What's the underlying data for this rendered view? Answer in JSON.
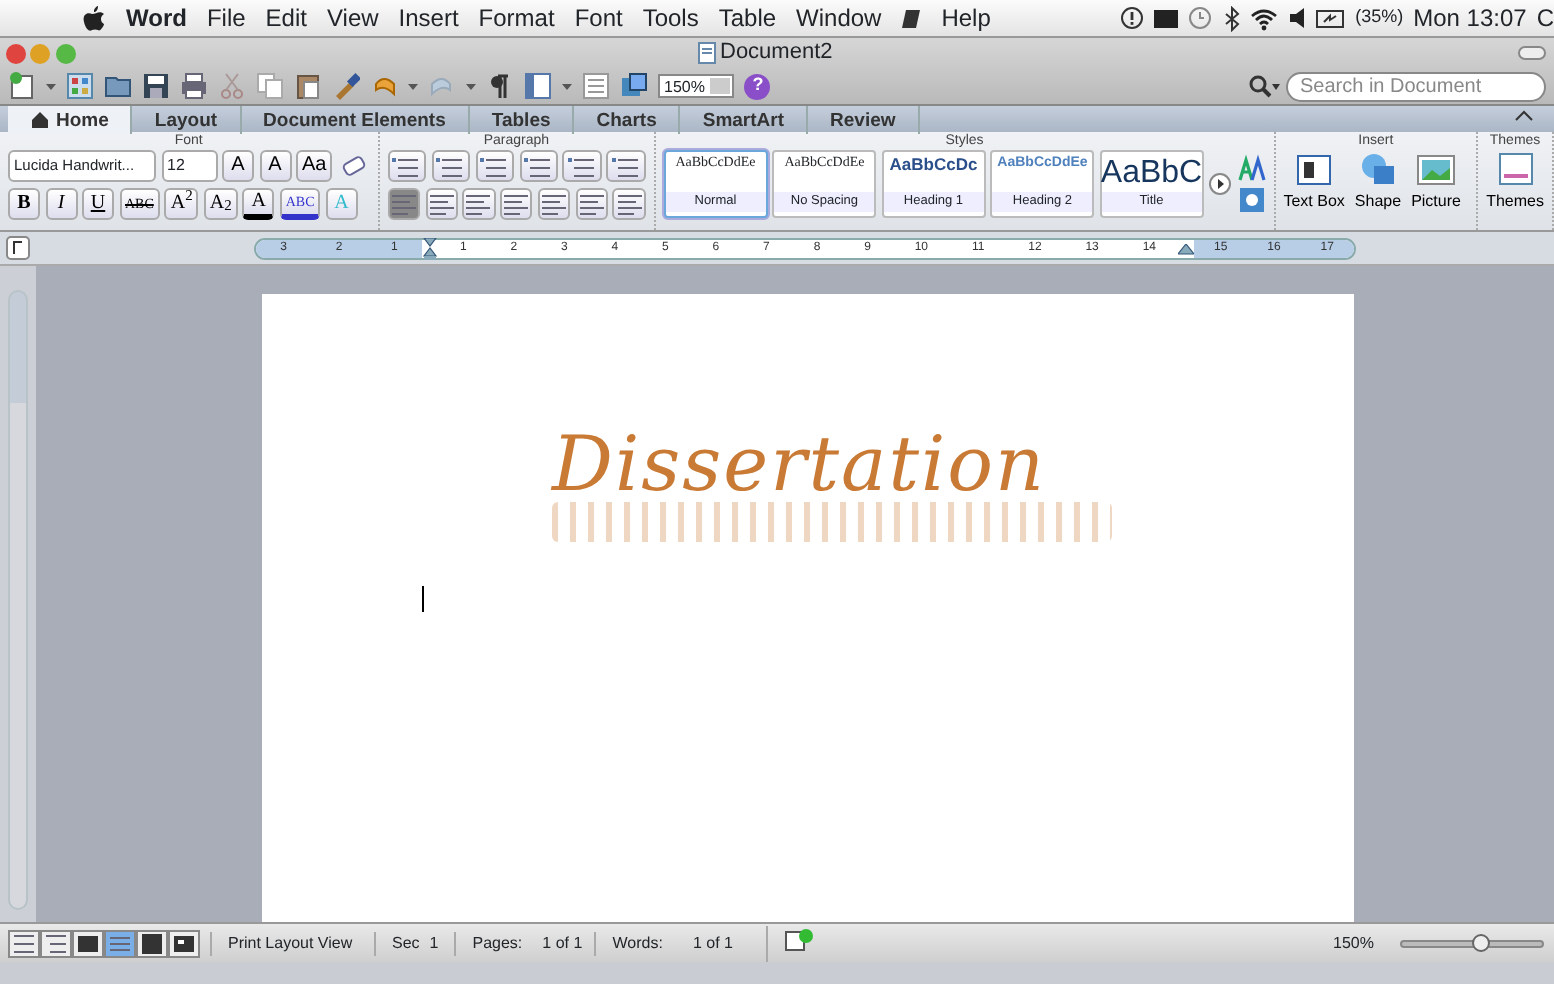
{
  "menu_bar": {
    "app": "Word",
    "items": [
      "File",
      "Edit",
      "View",
      "Insert",
      "Format",
      "Font",
      "Tools",
      "Table",
      "Window",
      "Help"
    ],
    "battery": "(35%)",
    "clock": "Mon 13:07",
    "cut_item": "C"
  },
  "window": {
    "title": "Document2"
  },
  "toolbar": {
    "zoom": "150%",
    "help": "?",
    "search": {
      "placeholder": "Search in Document"
    }
  },
  "tabs": [
    {
      "label": "Home",
      "selected": true
    },
    {
      "label": "Layout",
      "selected": false
    },
    {
      "label": "Document Elements",
      "selected": false
    },
    {
      "label": "Tables",
      "selected": false
    },
    {
      "label": "Charts",
      "selected": false
    },
    {
      "label": "SmartArt",
      "selected": false
    },
    {
      "label": "Review",
      "selected": false
    }
  ],
  "ribbon": {
    "font": {
      "title": "Font",
      "font_name": "Lucida Handwrit...",
      "font_size": "12",
      "row1": [
        "A",
        "A",
        "Aa"
      ],
      "row2": [
        "B",
        "I",
        "U",
        "ABC",
        "A$^{2}$",
        "A$_{2}$",
        "A",
        "ABC",
        "A"
      ]
    },
    "paragraph": {
      "title": "Paragraph"
    },
    "styles": {
      "title": "Styles",
      "items": [
        {
          "sample": "AaBbCcDdEe",
          "name": "Normal",
          "selected": true,
          "kind": "normal"
        },
        {
          "sample": "AaBbCcDdEe",
          "name": "No Spacing",
          "selected": false,
          "kind": "normal"
        },
        {
          "sample": "AaBbCcDc",
          "name": "Heading 1",
          "selected": false,
          "kind": "heading1"
        },
        {
          "sample": "AaBbCcDdEe",
          "name": "Heading 2",
          "selected": false,
          "kind": "heading2"
        },
        {
          "sample": "AaBbC",
          "name": "Title",
          "selected": false,
          "kind": "title"
        }
      ]
    },
    "insert": {
      "title": "Insert",
      "items": [
        "Text Box",
        "Shape",
        "Picture"
      ]
    },
    "themes": {
      "title": "Themes",
      "items": [
        "Themes"
      ]
    }
  },
  "ruler": {
    "left_labels": [
      "3",
      "2",
      "1"
    ],
    "right_labels": [
      "1",
      "2",
      "3",
      "4",
      "5",
      "6",
      "7",
      "8",
      "9",
      "10",
      "11",
      "12",
      "13",
      "14",
      "15",
      "16",
      "17"
    ]
  },
  "document": {
    "title": "Dissertation",
    "reflection": true
  },
  "status_bar": {
    "views": [
      {
        "selected": false
      },
      {
        "selected": false
      },
      {
        "selected": false
      },
      {
        "selected": true
      },
      {
        "selected": false
      },
      {
        "selected": false
      }
    ],
    "view_name": "Print Layout View",
    "sec_label": "Sec",
    "sec": "1",
    "pages_label": "Pages:",
    "pages": "1 of 1",
    "words_label": "Words:",
    "words": "1 of 1",
    "zoom": "150%",
    "zoom_slider": {
      "level": 0.55
    }
  }
}
